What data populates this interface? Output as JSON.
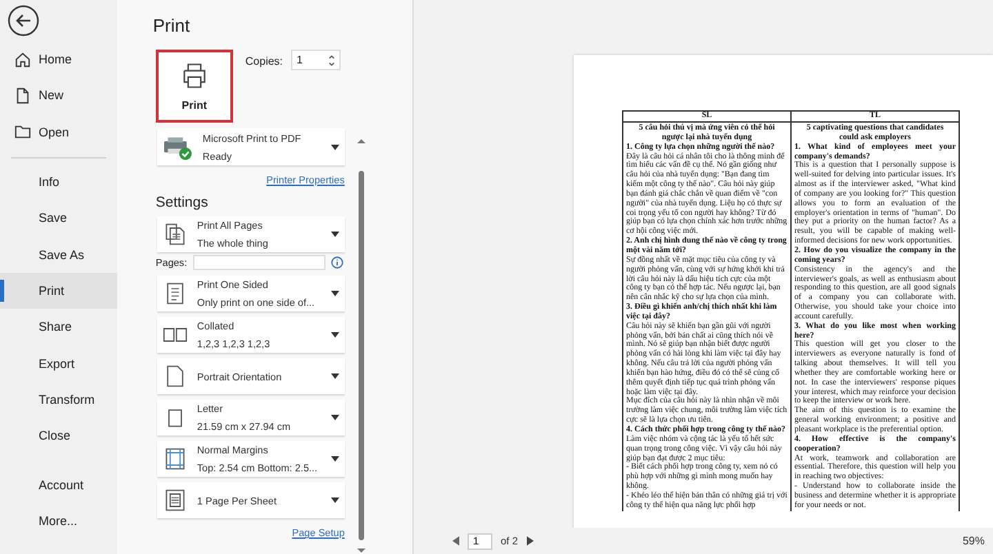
{
  "nav": {
    "top_items": [
      {
        "label": "Home",
        "kind": "home",
        "selected": false
      },
      {
        "label": "New",
        "kind": "new",
        "selected": false
      },
      {
        "label": "Open",
        "kind": "open",
        "selected": false
      }
    ],
    "items": [
      {
        "label": "Info",
        "selected": false
      },
      {
        "label": "Save",
        "selected": false
      },
      {
        "label": "Save As",
        "selected": false
      },
      {
        "label": "Print",
        "selected": true
      },
      {
        "label": "Share",
        "selected": false
      },
      {
        "label": "Export",
        "selected": false
      },
      {
        "label": "Transform",
        "selected": false
      },
      {
        "label": "Close",
        "selected": false
      }
    ],
    "bottom_items": [
      {
        "label": "Account",
        "selected": false
      },
      {
        "label": "More...",
        "selected": false
      }
    ]
  },
  "print": {
    "title": "Print",
    "button": "Print",
    "copies_label": "Copies:",
    "copies": "1",
    "printer": {
      "name": "Microsoft Print to PDF",
      "status": "Ready"
    },
    "printer_properties": "Printer Properties",
    "settings_title": "Settings",
    "settings": [
      {
        "kind": "pages",
        "title": "Print All Pages",
        "subtitle": "The whole thing"
      },
      {
        "kind": "field",
        "label": "Pages:"
      },
      {
        "kind": "sides",
        "title": "Print One Sided",
        "subtitle": "Only print on one side of..."
      },
      {
        "kind": "collate",
        "title": "Collated",
        "subtitle": "1,2,3    1,2,3    1,2,3"
      },
      {
        "kind": "orientation",
        "title": "Portrait Orientation"
      },
      {
        "kind": "paper",
        "title": "Letter",
        "subtitle": "21.59 cm x 27.94 cm"
      },
      {
        "kind": "margins",
        "title": "Normal Margins",
        "subtitle": "Top: 2.54 cm Bottom: 2.5..."
      },
      {
        "kind": "persheet",
        "title": "1 Page Per Sheet"
      }
    ],
    "page_setup": "Page Setup"
  },
  "preview": {
    "columns": [
      {
        "header": "SL",
        "blocks": [
          {
            "kind": "title",
            "text": "5 câu hỏi thú vị mà ứng viên có thể hỏi ngược lại nhà tuyển dụng"
          },
          {
            "kind": "heading",
            "text": "1. Công ty lựa chọn những người thế nào?"
          },
          {
            "kind": "text",
            "text": "Đây là câu hỏi cá nhân tôi cho là thông minh để tìm hiểu các vấn đề cụ thể. Nó gần giống như câu hỏi của nhà tuyển dụng: \"Bạn đang tìm kiếm một công ty thế nào\". Câu hỏi này giúp bạn đánh giá chắc chắn về quan điểm về \"con người\" của nhà tuyển dụng. Liệu họ có thực sự coi trọng yếu tố con người hay không? Từ đó giúp bạn có lựa chọn chính xác hơn trước những cơ hội công việc mới."
          },
          {
            "kind": "heading",
            "text": "2. Anh chị hình dung thế nào về công ty trong một vài năm tới?"
          },
          {
            "kind": "text",
            "text": "Sự đồng nhất về mặt mục tiêu của công ty và người phỏng vấn, cùng với sự hứng khởi khi trả lời câu hỏi này là dấu hiệu tích cực của một công ty bạn có thể hợp tác. Nếu ngược lại, bạn nên cân nhắc kỹ cho sự lựa chọn của mình."
          },
          {
            "kind": "heading",
            "text": "3. Điều gì khiến anh/chị thích nhất khi làm việc tại đây?"
          },
          {
            "kind": "text",
            "text": "Câu hỏi này sẽ khiến bạn gần gũi với người phỏng vấn, bởi bản chất ai cũng thích nói về mình. Nó sẽ giúp bạn nhận biết được người phỏng vấn có hài lòng khi làm việc tại đây hay không. Nếu câu trả lời của người phỏng vấn khiến bạn hào hứng, điều đó có thể sẽ củng cố thêm quyết định tiếp tục quá trình phỏng vấn hoặc làm việc tại đây."
          },
          {
            "kind": "text",
            "text": "Mục đích của câu hỏi này là nhìn nhận về môi trường làm việc chung, môi trường làm việc tích cực sẽ là lựa chọn ưu tiên."
          },
          {
            "kind": "heading",
            "text": "4. Cách thức phối hợp trong công ty thế nào?"
          },
          {
            "kind": "text",
            "text": "Làm việc nhóm và cộng tác là yếu tố hết sức quan trọng trong công việc. Vì vậy câu hỏi này giúp bạn đạt được 2 mục tiêu:"
          },
          {
            "kind": "text",
            "text": "- Biết cách phối hợp trong công ty, xem nó có phù hợp với những gì mình mong muốn hay không."
          },
          {
            "kind": "text",
            "text": "- Khéo léo thể hiện bản thân có những giá trị với công ty thể hiện qua năng lực phối hợp"
          }
        ]
      },
      {
        "header": "TL",
        "blocks": [
          {
            "kind": "title",
            "text": "5 captivating questions that candidates could ask employers"
          },
          {
            "kind": "heading",
            "text": "1. What kind of employees meet your company's demands?"
          },
          {
            "kind": "text",
            "text": "This is a question that I personally suppose is well-suited for delving into particular issues. It's almost as if the interviewer asked, \"What kind of company are you looking for?\" This question allows you to form an evaluation of the employer's orientation in terms of \"human\". Do they put a priority on the human factor? As a result, you will be capable of making well-informed decisions for new work opportunities."
          },
          {
            "kind": "heading",
            "text": "2. How do you visualize the company in the coming years?"
          },
          {
            "kind": "text",
            "text": "Consistency in the agency's and the interviewer's goals, as well as enthusiasm about responding to this question, are all good signals of a company you can collaborate with. Otherwise, you should take your choice into account carefully."
          },
          {
            "kind": "heading",
            "text": "3. What do you like most when working here?"
          },
          {
            "kind": "text",
            "text": "This question will get you closer to the interviewers as everyone naturally is fond of talking about themselves. It will tell you whether they are comfortable working here or not. In case the interviewers' response piques your interest, which may reinforce your decision to keep the interview or work here."
          },
          {
            "kind": "text",
            "text": "The aim of this question is to examine the general working environment; a positive and pleasant workplace is the preferential option."
          },
          {
            "kind": "heading",
            "text": "4. How effective is the company's cooperation?"
          },
          {
            "kind": "text",
            "text": "At work, teamwork and collaboration are essential. Therefore, this question will help you in reaching two objectives:"
          },
          {
            "kind": "text",
            "text": "- Understand how to collaborate inside the business and determine whether it is appropriate for your needs or not."
          }
        ]
      }
    ],
    "page": "1",
    "page_count": "of 2",
    "zoom": "59%"
  }
}
